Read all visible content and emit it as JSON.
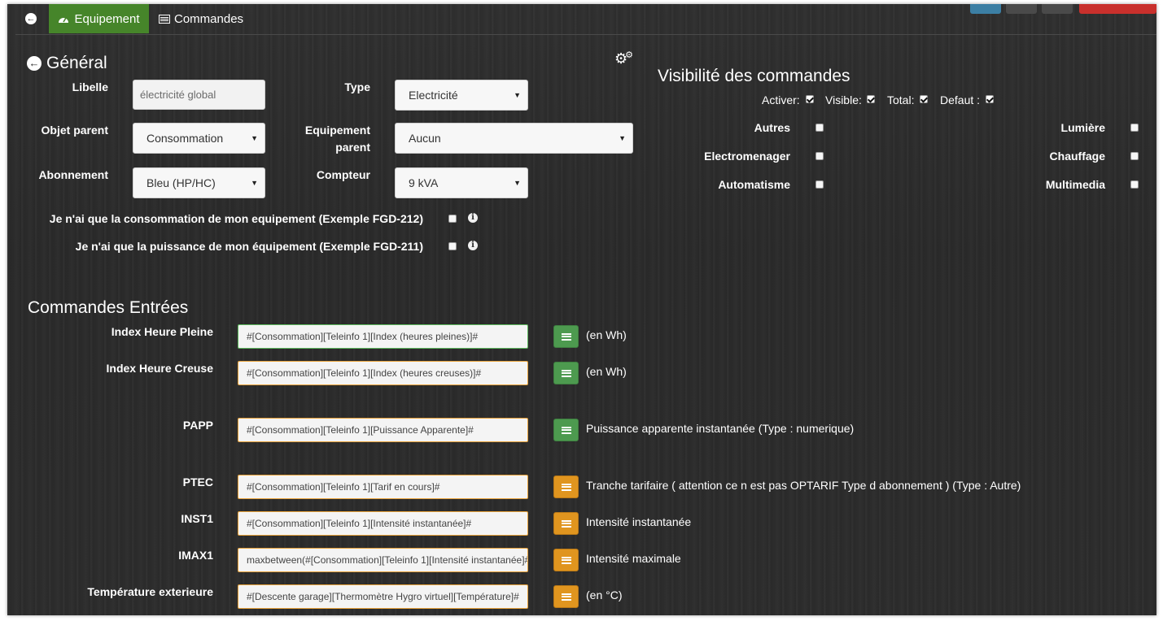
{
  "tabs": {
    "back_icon": "arrow-left-circle-icon",
    "equipement": "Equipement",
    "commandes": "Commandes"
  },
  "toolbar_colors": [
    "#3c8dbc",
    "#555555",
    "#555555",
    "#d9534f"
  ],
  "general": {
    "title": "Général",
    "libelle_label": "Libelle",
    "libelle_value": "électricité global",
    "type_label": "Type",
    "type_value": "Electricité",
    "objet_parent_label": "Objet parent",
    "objet_parent_value": "Consommation",
    "equipement_parent_label": "Equipement parent",
    "equipement_parent_value": "Aucun",
    "abonnement_label": "Abonnement",
    "abonnement_value": "Bleu (HP/HC)",
    "compteur_label": "Compteur",
    "compteur_value": "9 kVA",
    "conso_only_label": "Je n'ai que la consommation de mon equipement (Exemple FGD-212)",
    "conso_only_checked": false,
    "puissance_only_label": "Je n'ai que la puissance de mon équipement (Exemple FGD-211)",
    "puissance_only_checked": false
  },
  "visibility": {
    "title": "Visibilité des commandes",
    "activer_label": "Activer:",
    "visible_label": "Visible:",
    "total_label": "Total:",
    "defaut_label": "Defaut :",
    "activer_checked": true,
    "visible_checked": true,
    "total_checked": true,
    "defaut_checked": true,
    "left_items": [
      "Autres",
      "Electromenager",
      "Automatisme"
    ],
    "right_items": [
      "Lumière",
      "Chauffage",
      "Multimedia"
    ]
  },
  "commandes": {
    "title": "Commandes Entrées",
    "rows": [
      {
        "label": "Index Heure Pleine",
        "value": "#[Consommation][Teleinfo 1][Index (heures pleines)]#",
        "desc": "(en Wh)",
        "color": "green"
      },
      {
        "label": "Index Heure Creuse",
        "value": "#[Consommation][Teleinfo 1][Index (heures creuses)]#",
        "desc": "(en Wh)",
        "color": "green"
      },
      {
        "label": "PAPP",
        "value": "#[Consommation][Teleinfo 1][Puissance Apparente]#",
        "desc": "Puissance apparente instantanée (Type : numerique)",
        "color": "green"
      },
      {
        "label": "PTEC",
        "value": "#[Consommation][Teleinfo 1][Tarif en cours]#",
        "desc": "Tranche tarifaire ( attention ce n est pas OPTARIF Type d abonnement ) (Type : Autre)",
        "color": "orange"
      },
      {
        "label": "INST1",
        "value": "#[Consommation][Teleinfo 1][Intensité instantanée]#",
        "desc": "Intensité instantanée",
        "color": "orange"
      },
      {
        "label": "IMAX1",
        "value": "maxbetween(#[Consommation][Teleinfo 1][Intensité instantanée]#",
        "desc": "Intensité maximale",
        "color": "orange"
      },
      {
        "label": "Température exterieure",
        "value": "#[Descente garage][Thermomètre Hygro virtuel][Température]#",
        "desc": "(en °C)",
        "color": "orange"
      }
    ]
  }
}
